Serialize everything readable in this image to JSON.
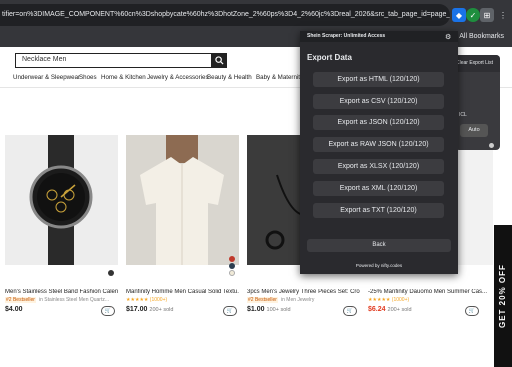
{
  "browser": {
    "url": "tifier=on%3DIMAGE_COMPONENT%60cn%3Dshopbycate%60hz%3DhotZone_2%60ps%3D4_2%60jc%3Dreal_2026&src_tab_page_id=page_home1742679332547&u",
    "all_bookmarks": "All Bookmarks"
  },
  "site": {
    "search_value": "Necklace Men",
    "nav": [
      "Underwear & Sleepwear",
      "Shoes",
      "Home & Kitchen",
      "Jewelry & Accessories",
      "Beauty & Health",
      "Baby & Maternity"
    ],
    "promo": "GET 20% OFF"
  },
  "products": [
    {
      "title": "Men's Stainless Steel Band Fashion Calen...",
      "tag": "#2 Bestseller",
      "tag2": "in Stainless Steel Men Quartz...",
      "price": "$4.00",
      "sold": ""
    },
    {
      "title": "Manfinity Homme Men Casual Solid Textu...",
      "tag": "★★★★★ (1000+)",
      "tag2": "",
      "price": "$17.00",
      "sold": "200+ sold"
    },
    {
      "title": "3pcs Men's Jewelry Three Pieces Set: Cro...",
      "tag": "#2 Bestseller",
      "tag2": "in Men Jewelry",
      "price": "$1.00",
      "sold": "100+ sold"
    },
    {
      "title": "-25% Manfinity Dauomo Men Summer Cas...",
      "tag": "★★★★★ (1000+)",
      "tag2": "",
      "price": "$6.24",
      "sold": "200+ sold"
    }
  ],
  "popup": {
    "header": "Shein Scraper: Unlimited Access",
    "title": "Export Data",
    "buttons": [
      "Export as HTML (120/120)",
      "Export as CSV (120/120)",
      "Export as JSON (120/120)",
      "Export as RAW JSON (120/120)",
      "Export as XLSX (120/120)",
      "Export as XML (120/120)",
      "Export as TXT (120/120)"
    ],
    "back": "Back",
    "footer": "Powered by nifty.codes"
  },
  "side_panel": {
    "clear_label": "Clear Export List",
    "auto_label": "Auto",
    "partial_text": "ICL"
  },
  "colors": {
    "accent_green": "#1e8e3e",
    "sale_red": "#e13a1f",
    "popup_bg": "#2a2a2e"
  }
}
